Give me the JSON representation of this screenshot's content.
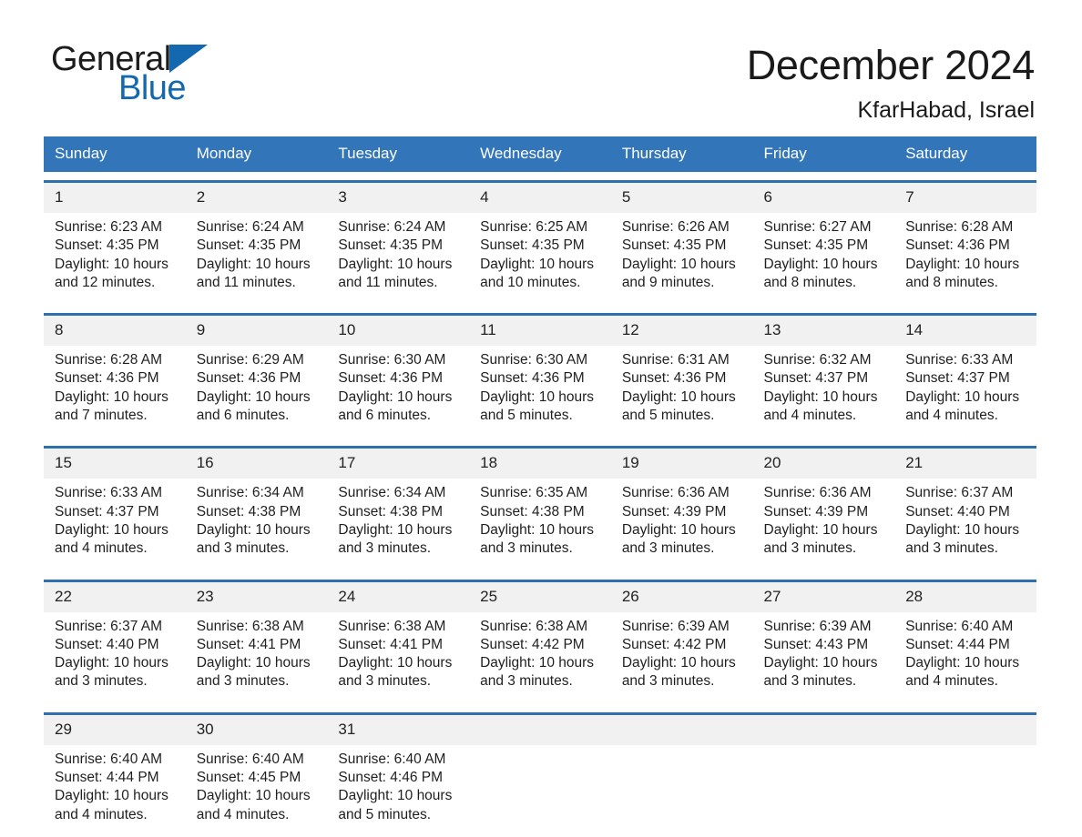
{
  "brand": {
    "name_part1": "General",
    "name_part2": "Blue",
    "accent_color": "#1368b0"
  },
  "header": {
    "title": "December 2024",
    "location": "KfarHabad, Israel"
  },
  "theme": {
    "header_bar_color": "#3275b9",
    "week_separator_color": "#2f6fae",
    "daynum_band_color": "#f1f1f1",
    "text_color": "#1a1a1a"
  },
  "weekday_headers": [
    "Sunday",
    "Monday",
    "Tuesday",
    "Wednesday",
    "Thursday",
    "Friday",
    "Saturday"
  ],
  "weeks": [
    [
      {
        "day": "1",
        "sunrise": "Sunrise: 6:23 AM",
        "sunset": "Sunset: 4:35 PM",
        "daylight_line1": "Daylight: 10 hours",
        "daylight_line2": "and 12 minutes."
      },
      {
        "day": "2",
        "sunrise": "Sunrise: 6:24 AM",
        "sunset": "Sunset: 4:35 PM",
        "daylight_line1": "Daylight: 10 hours",
        "daylight_line2": "and 11 minutes."
      },
      {
        "day": "3",
        "sunrise": "Sunrise: 6:24 AM",
        "sunset": "Sunset: 4:35 PM",
        "daylight_line1": "Daylight: 10 hours",
        "daylight_line2": "and 11 minutes."
      },
      {
        "day": "4",
        "sunrise": "Sunrise: 6:25 AM",
        "sunset": "Sunset: 4:35 PM",
        "daylight_line1": "Daylight: 10 hours",
        "daylight_line2": "and 10 minutes."
      },
      {
        "day": "5",
        "sunrise": "Sunrise: 6:26 AM",
        "sunset": "Sunset: 4:35 PM",
        "daylight_line1": "Daylight: 10 hours",
        "daylight_line2": "and 9 minutes."
      },
      {
        "day": "6",
        "sunrise": "Sunrise: 6:27 AM",
        "sunset": "Sunset: 4:35 PM",
        "daylight_line1": "Daylight: 10 hours",
        "daylight_line2": "and 8 minutes."
      },
      {
        "day": "7",
        "sunrise": "Sunrise: 6:28 AM",
        "sunset": "Sunset: 4:36 PM",
        "daylight_line1": "Daylight: 10 hours",
        "daylight_line2": "and 8 minutes."
      }
    ],
    [
      {
        "day": "8",
        "sunrise": "Sunrise: 6:28 AM",
        "sunset": "Sunset: 4:36 PM",
        "daylight_line1": "Daylight: 10 hours",
        "daylight_line2": "and 7 minutes."
      },
      {
        "day": "9",
        "sunrise": "Sunrise: 6:29 AM",
        "sunset": "Sunset: 4:36 PM",
        "daylight_line1": "Daylight: 10 hours",
        "daylight_line2": "and 6 minutes."
      },
      {
        "day": "10",
        "sunrise": "Sunrise: 6:30 AM",
        "sunset": "Sunset: 4:36 PM",
        "daylight_line1": "Daylight: 10 hours",
        "daylight_line2": "and 6 minutes."
      },
      {
        "day": "11",
        "sunrise": "Sunrise: 6:30 AM",
        "sunset": "Sunset: 4:36 PM",
        "daylight_line1": "Daylight: 10 hours",
        "daylight_line2": "and 5 minutes."
      },
      {
        "day": "12",
        "sunrise": "Sunrise: 6:31 AM",
        "sunset": "Sunset: 4:36 PM",
        "daylight_line1": "Daylight: 10 hours",
        "daylight_line2": "and 5 minutes."
      },
      {
        "day": "13",
        "sunrise": "Sunrise: 6:32 AM",
        "sunset": "Sunset: 4:37 PM",
        "daylight_line1": "Daylight: 10 hours",
        "daylight_line2": "and 4 minutes."
      },
      {
        "day": "14",
        "sunrise": "Sunrise: 6:33 AM",
        "sunset": "Sunset: 4:37 PM",
        "daylight_line1": "Daylight: 10 hours",
        "daylight_line2": "and 4 minutes."
      }
    ],
    [
      {
        "day": "15",
        "sunrise": "Sunrise: 6:33 AM",
        "sunset": "Sunset: 4:37 PM",
        "daylight_line1": "Daylight: 10 hours",
        "daylight_line2": "and 4 minutes."
      },
      {
        "day": "16",
        "sunrise": "Sunrise: 6:34 AM",
        "sunset": "Sunset: 4:38 PM",
        "daylight_line1": "Daylight: 10 hours",
        "daylight_line2": "and 3 minutes."
      },
      {
        "day": "17",
        "sunrise": "Sunrise: 6:34 AM",
        "sunset": "Sunset: 4:38 PM",
        "daylight_line1": "Daylight: 10 hours",
        "daylight_line2": "and 3 minutes."
      },
      {
        "day": "18",
        "sunrise": "Sunrise: 6:35 AM",
        "sunset": "Sunset: 4:38 PM",
        "daylight_line1": "Daylight: 10 hours",
        "daylight_line2": "and 3 minutes."
      },
      {
        "day": "19",
        "sunrise": "Sunrise: 6:36 AM",
        "sunset": "Sunset: 4:39 PM",
        "daylight_line1": "Daylight: 10 hours",
        "daylight_line2": "and 3 minutes."
      },
      {
        "day": "20",
        "sunrise": "Sunrise: 6:36 AM",
        "sunset": "Sunset: 4:39 PM",
        "daylight_line1": "Daylight: 10 hours",
        "daylight_line2": "and 3 minutes."
      },
      {
        "day": "21",
        "sunrise": "Sunrise: 6:37 AM",
        "sunset": "Sunset: 4:40 PM",
        "daylight_line1": "Daylight: 10 hours",
        "daylight_line2": "and 3 minutes."
      }
    ],
    [
      {
        "day": "22",
        "sunrise": "Sunrise: 6:37 AM",
        "sunset": "Sunset: 4:40 PM",
        "daylight_line1": "Daylight: 10 hours",
        "daylight_line2": "and 3 minutes."
      },
      {
        "day": "23",
        "sunrise": "Sunrise: 6:38 AM",
        "sunset": "Sunset: 4:41 PM",
        "daylight_line1": "Daylight: 10 hours",
        "daylight_line2": "and 3 minutes."
      },
      {
        "day": "24",
        "sunrise": "Sunrise: 6:38 AM",
        "sunset": "Sunset: 4:41 PM",
        "daylight_line1": "Daylight: 10 hours",
        "daylight_line2": "and 3 minutes."
      },
      {
        "day": "25",
        "sunrise": "Sunrise: 6:38 AM",
        "sunset": "Sunset: 4:42 PM",
        "daylight_line1": "Daylight: 10 hours",
        "daylight_line2": "and 3 minutes."
      },
      {
        "day": "26",
        "sunrise": "Sunrise: 6:39 AM",
        "sunset": "Sunset: 4:42 PM",
        "daylight_line1": "Daylight: 10 hours",
        "daylight_line2": "and 3 minutes."
      },
      {
        "day": "27",
        "sunrise": "Sunrise: 6:39 AM",
        "sunset": "Sunset: 4:43 PM",
        "daylight_line1": "Daylight: 10 hours",
        "daylight_line2": "and 3 minutes."
      },
      {
        "day": "28",
        "sunrise": "Sunrise: 6:40 AM",
        "sunset": "Sunset: 4:44 PM",
        "daylight_line1": "Daylight: 10 hours",
        "daylight_line2": "and 4 minutes."
      }
    ],
    [
      {
        "day": "29",
        "sunrise": "Sunrise: 6:40 AM",
        "sunset": "Sunset: 4:44 PM",
        "daylight_line1": "Daylight: 10 hours",
        "daylight_line2": "and 4 minutes."
      },
      {
        "day": "30",
        "sunrise": "Sunrise: 6:40 AM",
        "sunset": "Sunset: 4:45 PM",
        "daylight_line1": "Daylight: 10 hours",
        "daylight_line2": "and 4 minutes."
      },
      {
        "day": "31",
        "sunrise": "Sunrise: 6:40 AM",
        "sunset": "Sunset: 4:46 PM",
        "daylight_line1": "Daylight: 10 hours",
        "daylight_line2": "and 5 minutes."
      },
      {
        "day": "",
        "sunrise": "",
        "sunset": "",
        "daylight_line1": "",
        "daylight_line2": ""
      },
      {
        "day": "",
        "sunrise": "",
        "sunset": "",
        "daylight_line1": "",
        "daylight_line2": ""
      },
      {
        "day": "",
        "sunrise": "",
        "sunset": "",
        "daylight_line1": "",
        "daylight_line2": ""
      },
      {
        "day": "",
        "sunrise": "",
        "sunset": "",
        "daylight_line1": "",
        "daylight_line2": ""
      }
    ]
  ]
}
